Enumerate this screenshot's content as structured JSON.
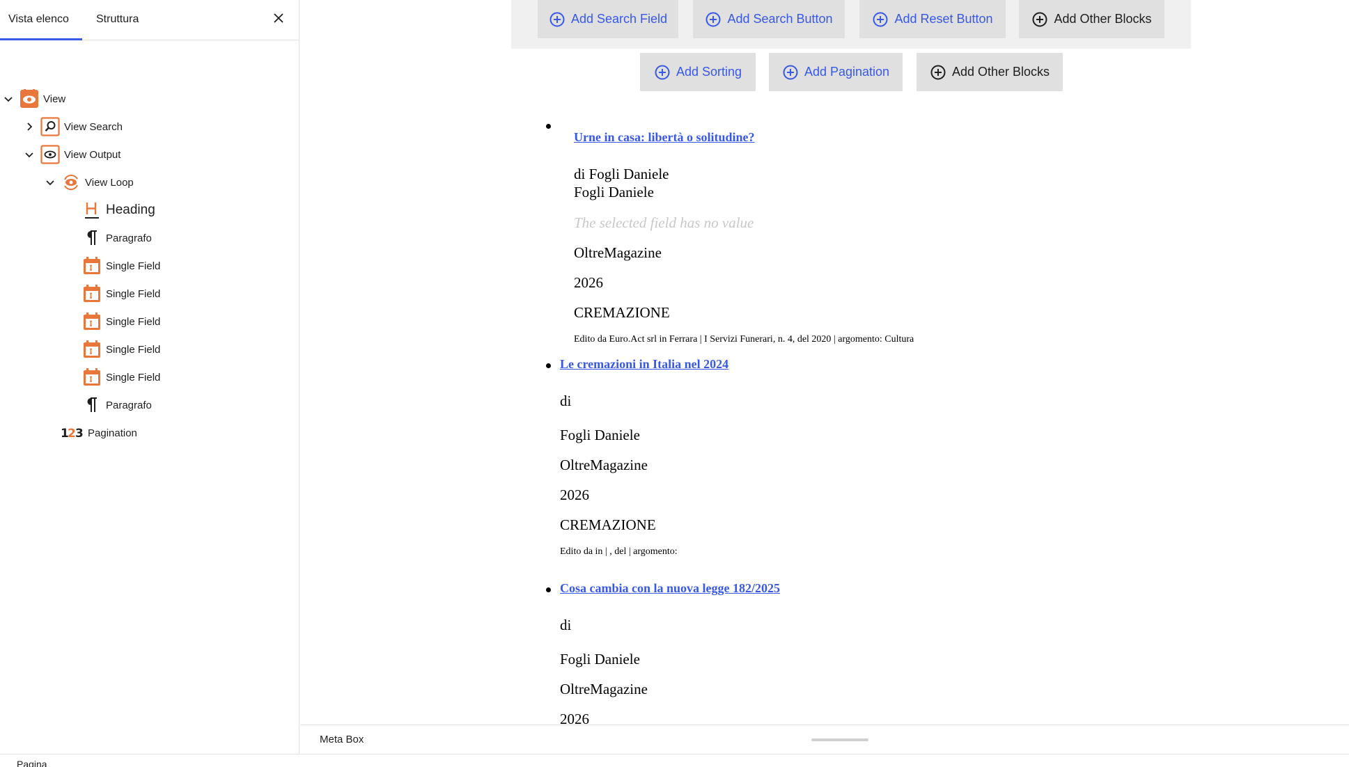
{
  "sidebar": {
    "tabs": [
      {
        "label": "Vista elenco",
        "active": true
      },
      {
        "label": "Struttura",
        "active": false
      }
    ],
    "tree": [
      {
        "label": "View",
        "icon": "eye-icon",
        "expanded": true,
        "depth": 0
      },
      {
        "label": "View Search",
        "icon": "search-icon",
        "expanded": false,
        "depth": 1
      },
      {
        "label": "View Output",
        "icon": "eye-icon",
        "expanded": true,
        "depth": 1
      },
      {
        "label": "View Loop",
        "icon": "loop-icon",
        "expanded": true,
        "depth": 2
      },
      {
        "label": "Heading",
        "icon": "heading-icon",
        "depth": 3
      },
      {
        "label": "Paragrafo",
        "icon": "paragraph-icon",
        "depth": 3
      },
      {
        "label": "Single Field",
        "icon": "calendar-field-icon",
        "depth": 3
      },
      {
        "label": "Single Field",
        "icon": "calendar-field-icon",
        "depth": 3
      },
      {
        "label": "Single Field",
        "icon": "calendar-field-icon",
        "depth": 3
      },
      {
        "label": "Single Field",
        "icon": "calendar-field-icon",
        "depth": 3
      },
      {
        "label": "Single Field",
        "icon": "calendar-field-icon",
        "depth": 3
      },
      {
        "label": "Paragrafo",
        "icon": "paragraph-icon",
        "depth": 3
      },
      {
        "label": "Pagination",
        "icon": "pagination-123-icon",
        "depth": 2
      }
    ]
  },
  "toolbar": {
    "row1": [
      {
        "label": "Add Search Field",
        "style": "primary"
      },
      {
        "label": "Add Search Button",
        "style": "primary"
      },
      {
        "label": "Add Reset Button",
        "style": "primary"
      },
      {
        "label": "Add Other Blocks",
        "style": "dark"
      }
    ],
    "row2": [
      {
        "label": "Add Sorting",
        "style": "primary"
      },
      {
        "label": "Add Pagination",
        "style": "primary"
      },
      {
        "label": "Add Other Blocks",
        "style": "dark"
      }
    ]
  },
  "items": [
    {
      "title": "Urne in casa: libertà o solitudine?",
      "author_line": "di Fogli Daniele",
      "author": "Fogli Daniele",
      "empty_field": "The selected field has no value",
      "publication": "OltreMagazine",
      "year": "2026",
      "category": "CREMAZIONE",
      "footer": "Edito da Euro.Act srl in Ferrara | I Servizi Funerari, n. 4, del 2020 | argomento: Cultura"
    },
    {
      "title": "Le cremazioni in Italia nel 2024",
      "author_line": "di",
      "author": "Fogli Daniele",
      "publication": "OltreMagazine",
      "year": "2026",
      "category": "CREMAZIONE",
      "footer": "Edito da in | , del | argomento:"
    },
    {
      "title": "Cosa cambia con la nuova legge 182/2025",
      "author_line": "di",
      "author": "Fogli Daniele",
      "publication": "OltreMagazine",
      "year": "2026"
    }
  ],
  "metabox": {
    "label": "Meta Box"
  },
  "footer": {
    "label": "Pagina"
  },
  "colors": {
    "accent": "#3858e9",
    "icon_orange": "#e9763a",
    "button_bg": "#e0e0e0",
    "toolbar_bg": "#f0f0f0"
  }
}
